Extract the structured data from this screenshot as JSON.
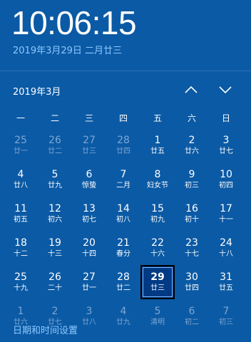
{
  "clock": {
    "time": "10:06:15",
    "date_text": "2019年3月29日 二月廿三"
  },
  "calendar": {
    "month_label": "2019年3月",
    "weekdays": [
      "一",
      "二",
      "三",
      "四",
      "五",
      "六",
      "日"
    ],
    "weeks": [
      [
        {
          "num": "25",
          "lunar": "廿一",
          "state": "other"
        },
        {
          "num": "26",
          "lunar": "廿二",
          "state": "other"
        },
        {
          "num": "27",
          "lunar": "廿三",
          "state": "other"
        },
        {
          "num": "28",
          "lunar": "廿四",
          "state": "other"
        },
        {
          "num": "1",
          "lunar": "廿五",
          "state": "cur"
        },
        {
          "num": "2",
          "lunar": "廿六",
          "state": "cur"
        },
        {
          "num": "3",
          "lunar": "廿七",
          "state": "cur"
        }
      ],
      [
        {
          "num": "4",
          "lunar": "廿八",
          "state": "cur"
        },
        {
          "num": "5",
          "lunar": "廿九",
          "state": "cur"
        },
        {
          "num": "6",
          "lunar": "惊蛰",
          "state": "cur"
        },
        {
          "num": "7",
          "lunar": "二月",
          "state": "cur"
        },
        {
          "num": "8",
          "lunar": "妇女节",
          "state": "cur"
        },
        {
          "num": "9",
          "lunar": "初三",
          "state": "cur"
        },
        {
          "num": "10",
          "lunar": "初四",
          "state": "cur"
        }
      ],
      [
        {
          "num": "11",
          "lunar": "初五",
          "state": "cur"
        },
        {
          "num": "12",
          "lunar": "初六",
          "state": "cur"
        },
        {
          "num": "13",
          "lunar": "初七",
          "state": "cur"
        },
        {
          "num": "14",
          "lunar": "初八",
          "state": "cur"
        },
        {
          "num": "15",
          "lunar": "初九",
          "state": "cur"
        },
        {
          "num": "16",
          "lunar": "初十",
          "state": "cur"
        },
        {
          "num": "17",
          "lunar": "十一",
          "state": "cur"
        }
      ],
      [
        {
          "num": "18",
          "lunar": "十二",
          "state": "cur"
        },
        {
          "num": "19",
          "lunar": "十三",
          "state": "cur"
        },
        {
          "num": "20",
          "lunar": "十四",
          "state": "cur"
        },
        {
          "num": "21",
          "lunar": "春分",
          "state": "cur"
        },
        {
          "num": "22",
          "lunar": "十六",
          "state": "cur"
        },
        {
          "num": "23",
          "lunar": "十七",
          "state": "cur"
        },
        {
          "num": "24",
          "lunar": "十八",
          "state": "cur"
        }
      ],
      [
        {
          "num": "25",
          "lunar": "十九",
          "state": "cur"
        },
        {
          "num": "26",
          "lunar": "二十",
          "state": "cur"
        },
        {
          "num": "27",
          "lunar": "廿一",
          "state": "cur"
        },
        {
          "num": "28",
          "lunar": "廿二",
          "state": "cur"
        },
        {
          "num": "29",
          "lunar": "廿三",
          "state": "today"
        },
        {
          "num": "30",
          "lunar": "廿四",
          "state": "cur"
        },
        {
          "num": "31",
          "lunar": "廿五",
          "state": "cur"
        }
      ],
      [
        {
          "num": "1",
          "lunar": "廿六",
          "state": "other"
        },
        {
          "num": "2",
          "lunar": "廿七",
          "state": "other"
        },
        {
          "num": "3",
          "lunar": "廿八",
          "state": "other"
        },
        {
          "num": "4",
          "lunar": "廿九",
          "state": "other"
        },
        {
          "num": "5",
          "lunar": "清明",
          "state": "other"
        },
        {
          "num": "6",
          "lunar": "初二",
          "state": "other"
        },
        {
          "num": "7",
          "lunar": "初三",
          "state": "other"
        }
      ]
    ]
  },
  "footer": {
    "settings_link": "日期和时间设置"
  },
  "icons": {
    "prev": "chevron-up-icon",
    "next": "chevron-down-icon"
  },
  "colors": {
    "background": "#0b5aa5",
    "link": "#8cc8ff",
    "today_bg": "#003a85"
  }
}
